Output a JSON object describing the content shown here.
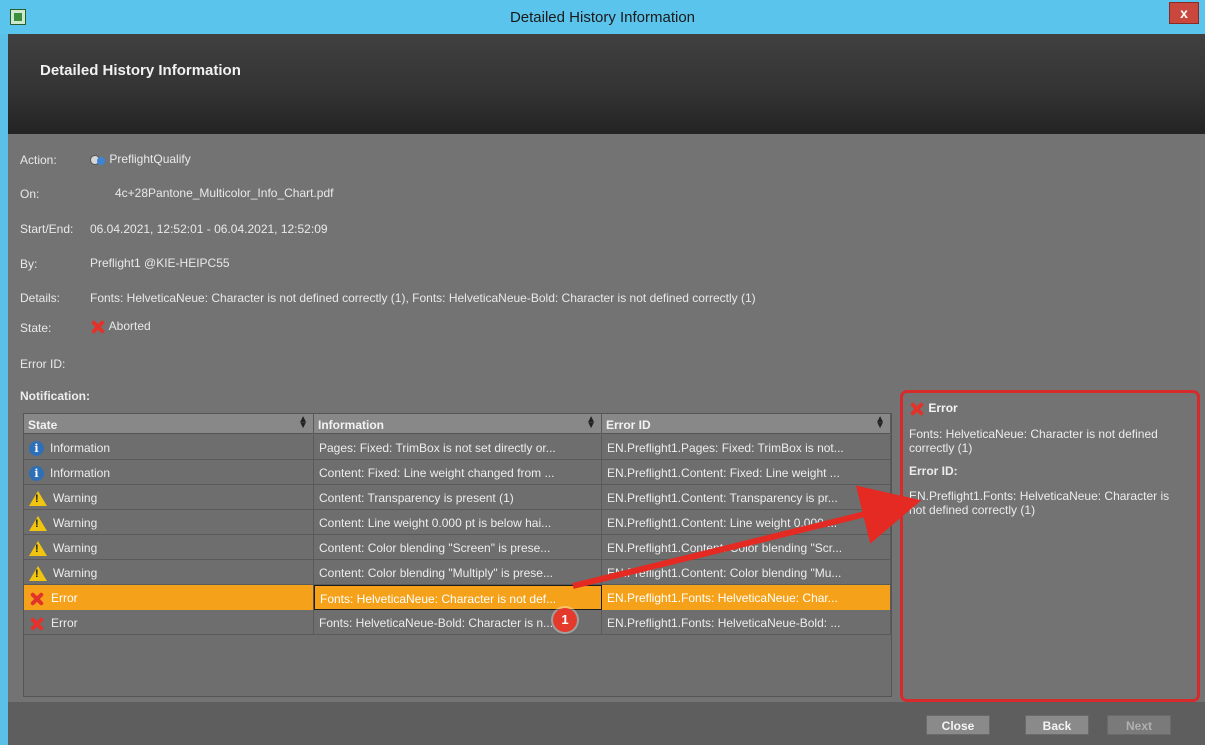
{
  "window": {
    "title": "Detailed History Information",
    "close_glyph": "x"
  },
  "header": {
    "title": "Detailed History Information"
  },
  "fields": {
    "action_label": "Action:",
    "action_value": "PreflightQualify",
    "on_label": "On:",
    "on_value": "4c+28Pantone_Multicolor_Info_Chart.pdf",
    "startend_label": "Start/End:",
    "startend_value": "06.04.2021, 12:52:01 - 06.04.2021, 12:52:09",
    "by_label": "By:",
    "by_value": "Preflight1 @KIE-HEIPC55",
    "details_label": "Details:",
    "details_value": "Fonts: HelveticaNeue: Character is not defined correctly (1), Fonts: HelveticaNeue-Bold: Character is not defined correctly (1)",
    "state_label": "State:",
    "state_value": "Aborted",
    "errorid_label": "Error ID:"
  },
  "notification": {
    "label": "Notification:",
    "columns": [
      "State",
      "Information",
      "Error ID"
    ],
    "rows": [
      {
        "icon": "info-icon",
        "state": "Information",
        "info": "Pages: Fixed: TrimBox is not set directly or...",
        "error_id": "EN.Preflight1.Pages: Fixed: TrimBox is not..."
      },
      {
        "icon": "info-icon",
        "state": "Information",
        "info": "Content: Fixed: Line weight changed from ...",
        "error_id": "EN.Preflight1.Content: Fixed: Line weight ..."
      },
      {
        "icon": "warning-icon",
        "state": "Warning",
        "info": "Content: Transparency is present (1)",
        "error_id": "EN.Preflight1.Content: Transparency is pr..."
      },
      {
        "icon": "warning-icon",
        "state": "Warning",
        "info": "Content: Line weight 0.000 pt is below hai...",
        "error_id": "EN.Preflight1.Content: Line weight 0.000 ..."
      },
      {
        "icon": "warning-icon",
        "state": "Warning",
        "info": "Content: Color blending \"Screen\" is prese...",
        "error_id": "EN.Preflight1.Content: Color blending \"Scr..."
      },
      {
        "icon": "warning-icon",
        "state": "Warning",
        "info": "Content: Color blending \"Multiply\" is prese...",
        "error_id": "EN.Preflight1.Content: Color blending \"Mu..."
      },
      {
        "icon": "error-icon",
        "state": "Error",
        "info": "Fonts: HelveticaNeue: Character is not def...",
        "error_id": "EN.Preflight1.Fonts: HelveticaNeue: Char...",
        "selected": true
      },
      {
        "icon": "error-icon",
        "state": "Error",
        "info": "Fonts: HelveticaNeue-Bold: Character is n...",
        "error_id": "EN.Preflight1.Fonts: HelveticaNeue-Bold: ..."
      }
    ]
  },
  "detail_panel": {
    "title": "Error",
    "message": "Fonts: HelveticaNeue: Character is not defined correctly (1)",
    "errorid_label": "Error ID:",
    "errorid_value": "EN.Preflight1.Fonts: HelveticaNeue: Character is not defined correctly (1)"
  },
  "annotation": {
    "badge": "1"
  },
  "buttons": {
    "close": "Close",
    "back": "Back",
    "next": "Next"
  },
  "colors": {
    "selection": "#f5a21a",
    "highlight_border": "#d72a2a",
    "titlebar": "#5bc4ec"
  }
}
